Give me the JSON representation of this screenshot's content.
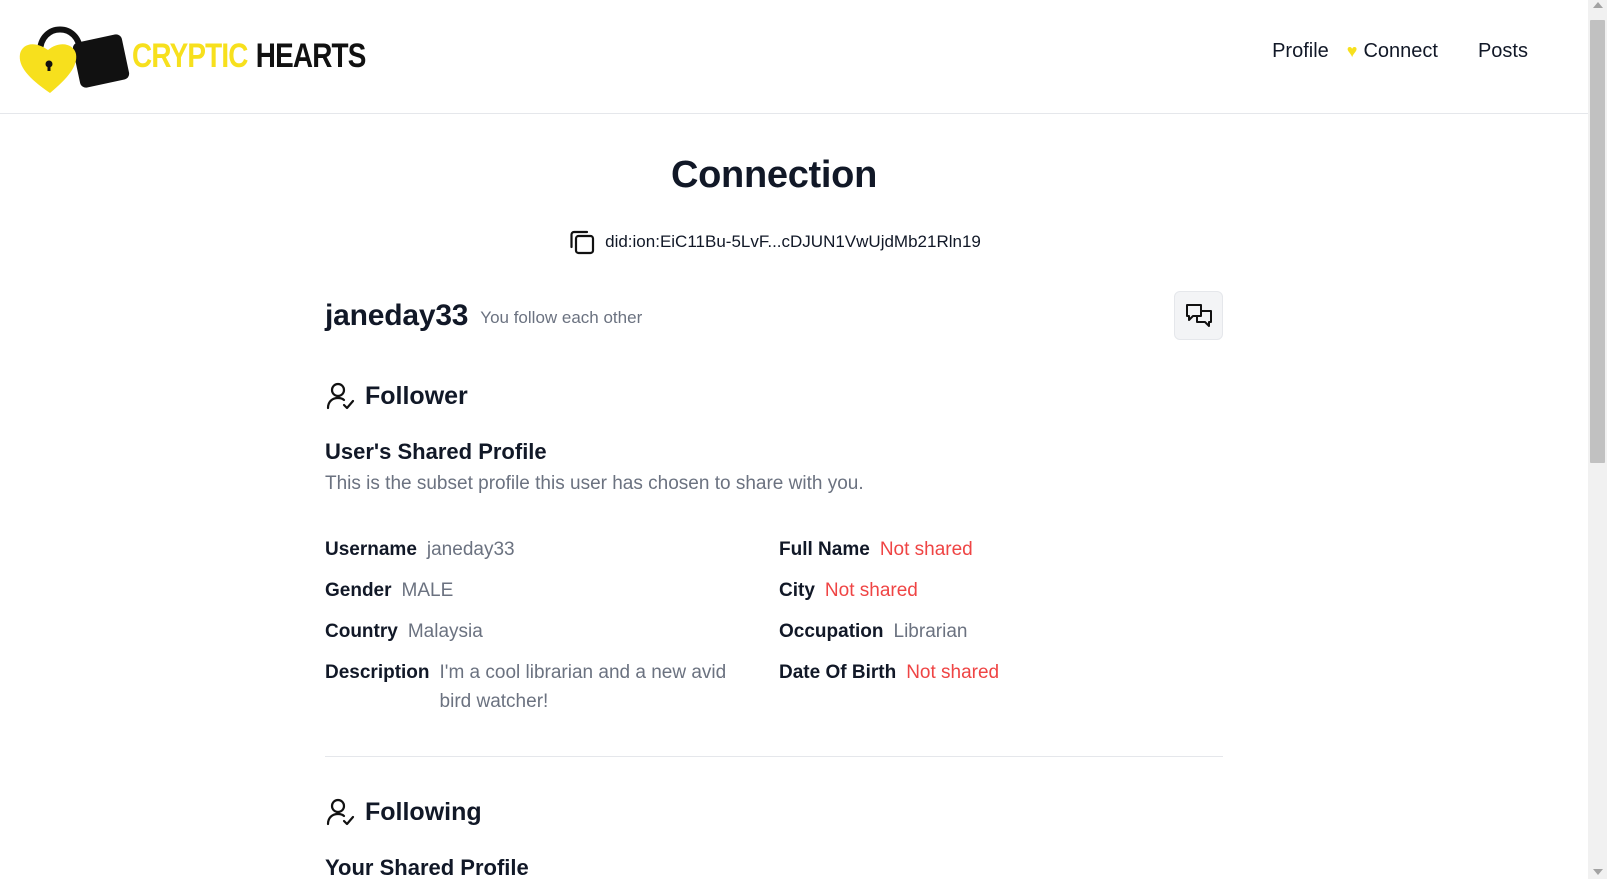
{
  "header": {
    "logo": {
      "word1": "CRYPTIC",
      "word2": "HEARTS"
    },
    "nav": {
      "profile": "Profile",
      "connect": "Connect",
      "posts": "Posts"
    },
    "colors": {
      "brand_yellow": "#f7e01d",
      "text_dark": "#111827"
    }
  },
  "main": {
    "title": "Connection",
    "did": "did:ion:EiC11Bu-5LvF...cDJUN1VwUjdMb21Rln19",
    "username": "janeday33",
    "follow_status": "You follow each other",
    "follower_section": {
      "title": "Follower",
      "subtitle": "User's Shared Profile",
      "description": "This is the subset profile this user has chosen to share with you.",
      "fields": {
        "username": {
          "label": "Username",
          "value": "janeday33"
        },
        "full_name": {
          "label": "Full Name",
          "value": "Not shared"
        },
        "gender": {
          "label": "Gender",
          "value": "MALE"
        },
        "city": {
          "label": "City",
          "value": "Not shared"
        },
        "country": {
          "label": "Country",
          "value": "Malaysia"
        },
        "occupation": {
          "label": "Occupation",
          "value": "Librarian"
        },
        "description": {
          "label": "Description",
          "value": "I'm a cool librarian and a new avid bird watcher!"
        },
        "dob": {
          "label": "Date Of Birth",
          "value": "Not shared"
        }
      }
    },
    "following_section": {
      "title": "Following",
      "subtitle": "Your Shared Profile"
    }
  }
}
